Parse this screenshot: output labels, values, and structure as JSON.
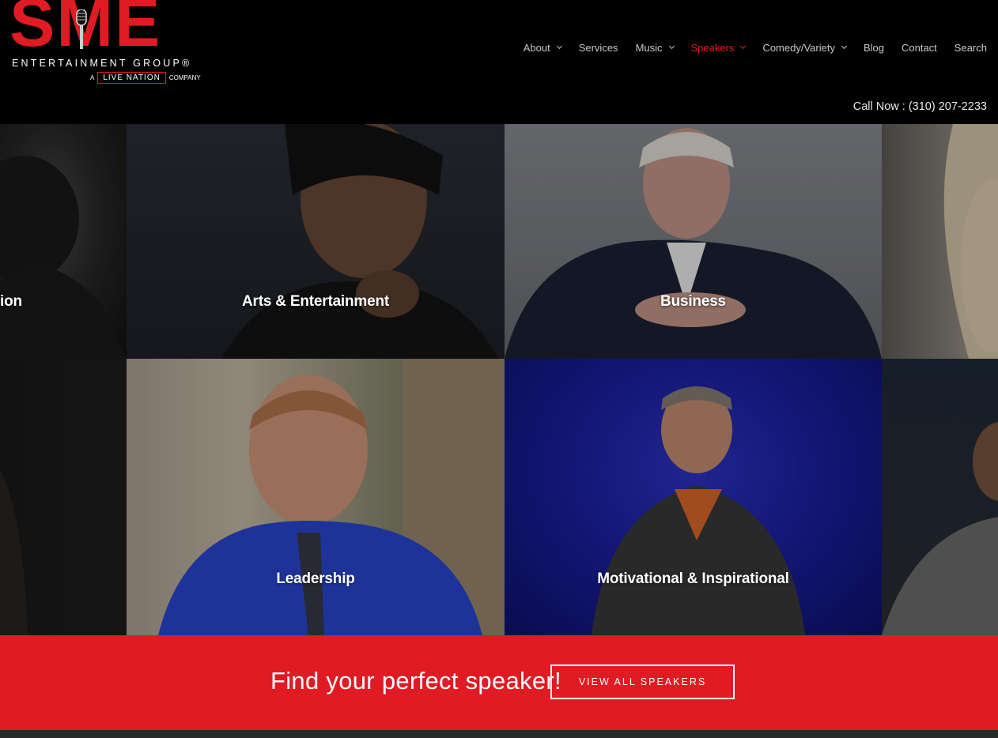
{
  "brand": {
    "logo_main": "SME",
    "logo_subtitle": "ENTERTAINMENT GROUP®",
    "logo_tag_prefix": "A",
    "logo_tag_brand": "LIVE NATION",
    "logo_tag_suffix": "COMPANY",
    "accent_color": "#e01b24"
  },
  "nav": {
    "items": [
      {
        "label": "About",
        "has_dropdown": true
      },
      {
        "label": "Services",
        "has_dropdown": false
      },
      {
        "label": "Music",
        "has_dropdown": true
      },
      {
        "label": "Speakers",
        "has_dropdown": true,
        "active": true
      },
      {
        "label": "Comedy/Variety",
        "has_dropdown": true
      },
      {
        "label": "Blog",
        "has_dropdown": false
      },
      {
        "label": "Contact",
        "has_dropdown": false
      },
      {
        "label": "Search",
        "has_dropdown": false
      }
    ],
    "call_now": "Call Now : (310) 207-2233"
  },
  "tiles": {
    "row1_partial_left": "ion",
    "arts": "Arts & Entertainment",
    "business": "Business",
    "leadership": "Leadership",
    "motivational": "Motivational & Inspirational"
  },
  "cta": {
    "headline": "Find your perfect speaker!",
    "button_label": "VIEW ALL SPEAKERS"
  }
}
